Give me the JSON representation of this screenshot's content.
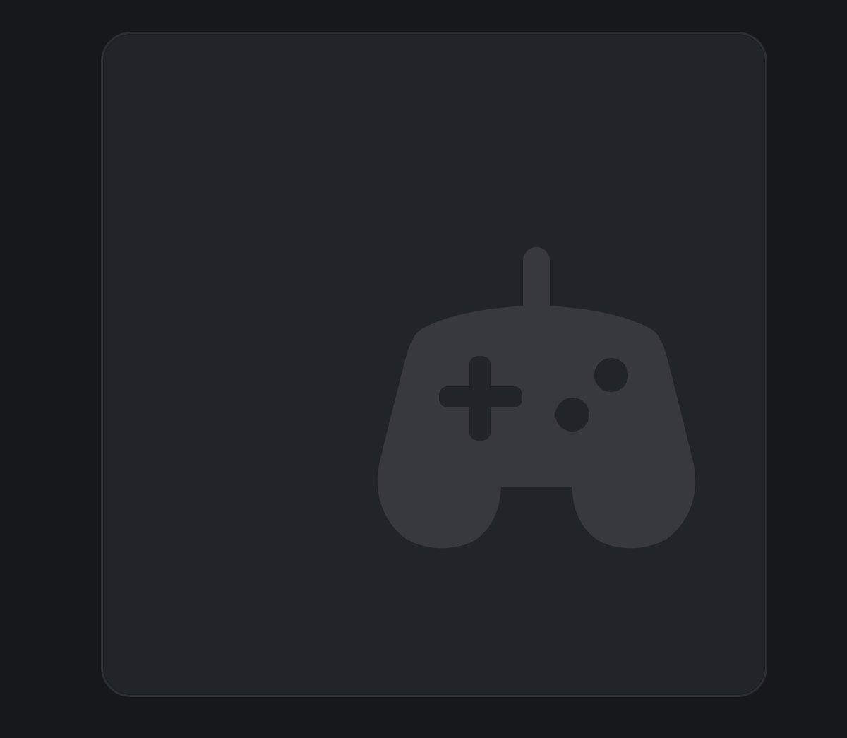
{
  "tile": {
    "icon": "gamepad-icon",
    "colors": {
      "page_background": "#16181c",
      "tile_background": "#212428",
      "tile_border": "#2b2e32",
      "icon_fill": "#38393f",
      "icon_cutout": "#212428"
    }
  }
}
